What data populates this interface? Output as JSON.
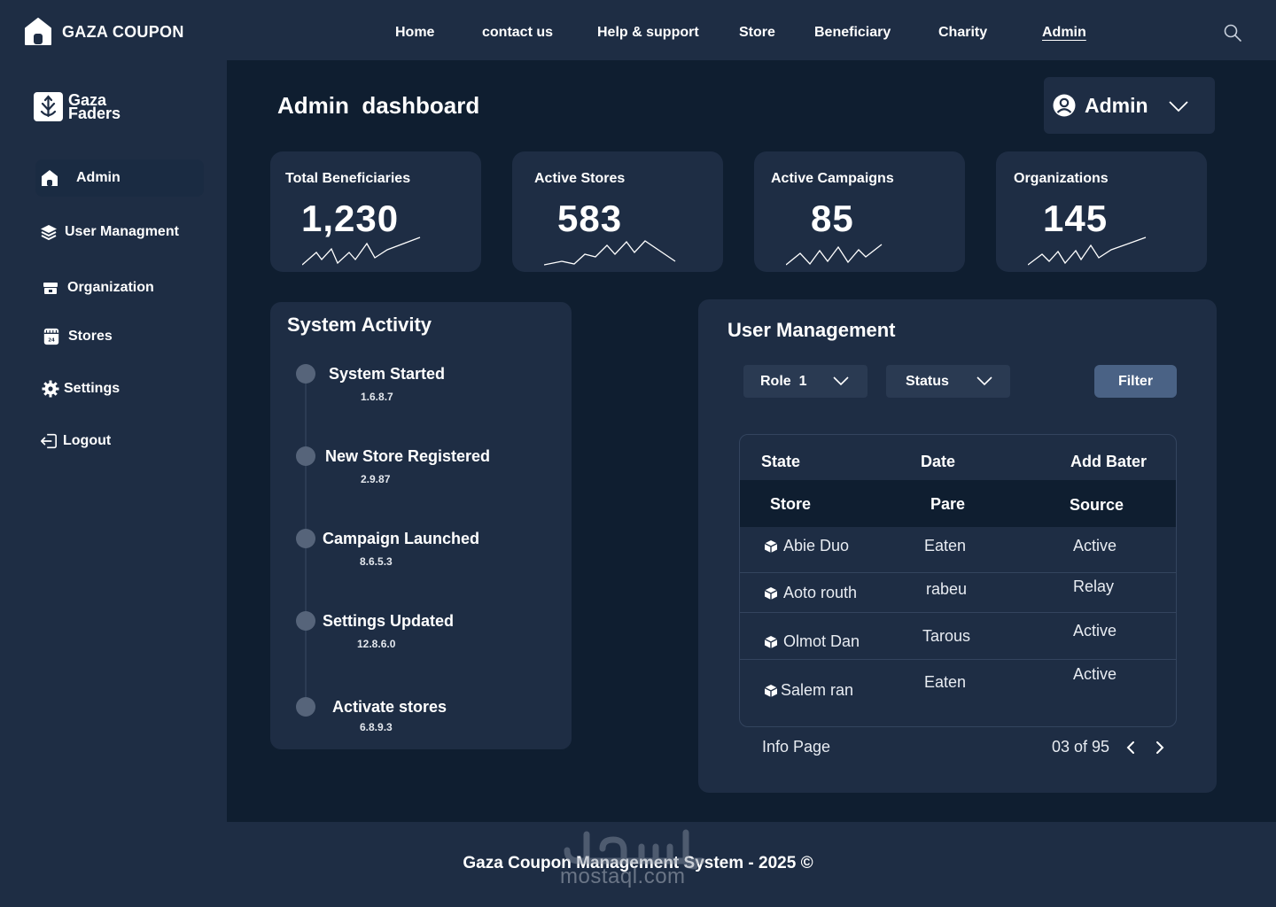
{
  "brand": {
    "name": "GAZA COUPON"
  },
  "nav": {
    "items": [
      {
        "label": "Home"
      },
      {
        "label": "contact us"
      },
      {
        "label": "Help & support"
      },
      {
        "label": "Store"
      },
      {
        "label": "Beneficiary"
      },
      {
        "label": "Charity"
      },
      {
        "label": "Admin",
        "active": true
      }
    ]
  },
  "sidebar": {
    "logo_line1": "Gaza",
    "logo_line2": "Faders",
    "items": [
      {
        "label": "Admin",
        "icon": "home-icon",
        "active": true
      },
      {
        "label": "User Managment",
        "icon": "layers-icon"
      },
      {
        "label": "Organization",
        "icon": "organization-icon"
      },
      {
        "label": "Stores",
        "icon": "store-icon"
      },
      {
        "label": "Settings",
        "icon": "gear-icon"
      },
      {
        "label": "Logout",
        "icon": "logout-icon"
      }
    ]
  },
  "header": {
    "title": "Admin  dashboard",
    "user_label": "Admin"
  },
  "stats": [
    {
      "label": "Total Beneficiaries",
      "value": "1,230"
    },
    {
      "label": "Active Stores",
      "value": "583"
    },
    {
      "label": "Active Campaigns",
      "value": "85"
    },
    {
      "label": "Organizations",
      "value": "145"
    }
  ],
  "activity": {
    "title": "System Activity",
    "items": [
      {
        "title": "System Started",
        "version": "1.6.8.7"
      },
      {
        "title": "New Store Registered",
        "version": "2.9.87"
      },
      {
        "title": "Campaign Launched",
        "version": "8.6.5.3"
      },
      {
        "title": "Settings Updated",
        "version": "12.8.6.0"
      },
      {
        "title": "Activate stores",
        "version": "6.8.9.3"
      }
    ]
  },
  "user_management": {
    "title": "User Management",
    "role_select": "Role  1",
    "status_select": "Status",
    "filter_label": "Filter",
    "header_row_1": [
      "State",
      "Date",
      "Add Bater"
    ],
    "header_row_2": [
      "Store",
      "Pare",
      "Source"
    ],
    "rows": [
      {
        "name": "Abie Duo",
        "col2": "Eaten",
        "col3": "Active"
      },
      {
        "name": "Aoto routh",
        "col2": "rabeu",
        "col3": "Relay"
      },
      {
        "name": "Olmot Dan",
        "col2": "Tarous",
        "col3": "Active"
      },
      {
        "name": "Salem ran",
        "col2": "Eaten",
        "col3": "Active"
      }
    ],
    "pager_info": "Info Page",
    "pager_count": "03 of 95"
  },
  "footer": {
    "text": "Gaza Coupon Management System - 2025 ©"
  },
  "watermark": {
    "latin": "mostaql.com"
  }
}
